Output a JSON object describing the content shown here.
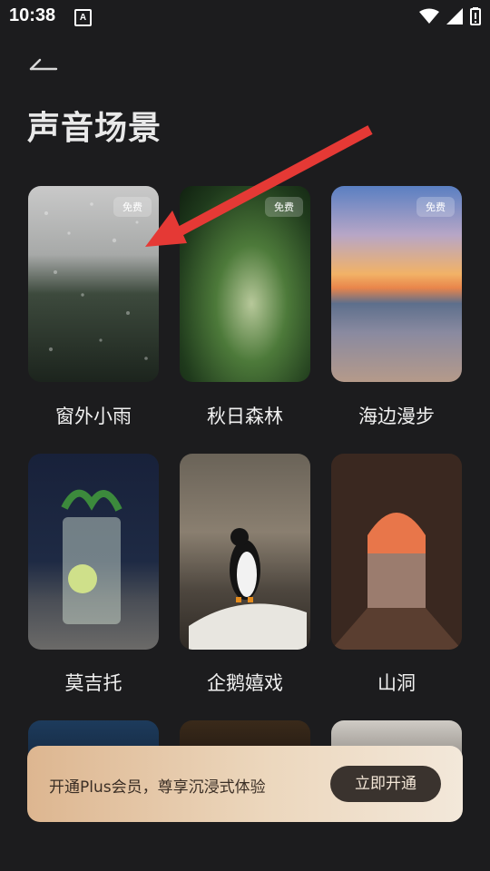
{
  "status_bar": {
    "time": "10:38",
    "notification": "A"
  },
  "header": {
    "title": "声音场景"
  },
  "scenes": [
    {
      "label": "窗外小雨",
      "badge": "免费"
    },
    {
      "label": "秋日森林",
      "badge": "免费"
    },
    {
      "label": "海边漫步",
      "badge": "免费"
    },
    {
      "label": "莫吉托",
      "badge": ""
    },
    {
      "label": "企鹅嬉戏",
      "badge": ""
    },
    {
      "label": "山洞",
      "badge": ""
    }
  ],
  "promo": {
    "text": "开通Plus会员，尊享沉浸式体验",
    "button_label": "立即开通"
  },
  "colors": {
    "background": "#1c1c1e",
    "arrow": "#e53935",
    "promo_button": "#3a332e"
  }
}
